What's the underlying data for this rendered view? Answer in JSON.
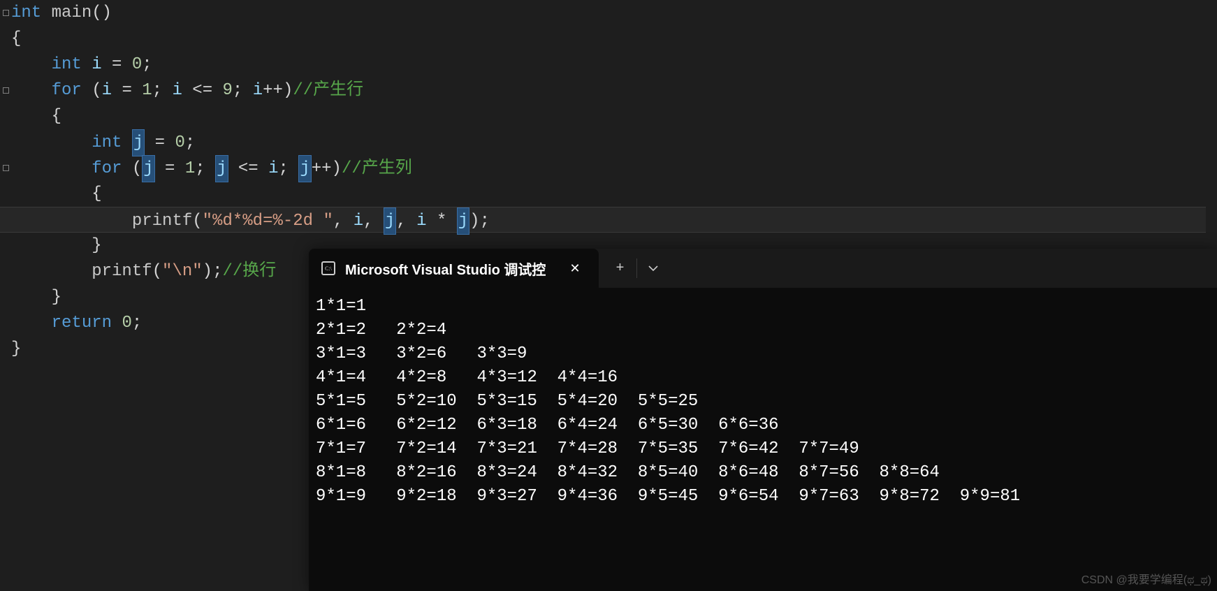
{
  "code": {
    "l1": {
      "int": "int",
      "sp": " ",
      "main": "main",
      "open": "(",
      "close": ")"
    },
    "l2": {
      "brace": "{"
    },
    "l3": {
      "pad": "    ",
      "int": "int",
      "sp": " ",
      "id": "i",
      "eq": " = ",
      "num": "0",
      "semi": ";"
    },
    "l4": {
      "pad": "    ",
      "for": "for",
      "sp": " (",
      "id1": "i",
      "eq1": " = ",
      "n1": "1",
      "semi1": "; ",
      "id2": "i",
      "le": " <= ",
      "n2": "9",
      "semi2": "; ",
      "id3": "i",
      "pp": "++",
      ")": ")",
      "cmm": "//产生行"
    },
    "l5": {
      "pad": "    ",
      "brace": "{"
    },
    "l6": {
      "pad": "        ",
      "int": "int",
      "sp": " ",
      "semi": ";",
      "j": "j",
      "eq": " = ",
      "num": "0"
    },
    "l7": {
      "pad": "        ",
      "for": "for",
      "sp": " (",
      "eq1": " = ",
      "n1": "1",
      "semi1": "; ",
      "le": " <= ",
      "idi": "i",
      "semi2": "; ",
      "pp": "++",
      ")": ")",
      "cmm": "//产生列",
      "j": "j"
    },
    "l8": {
      "pad": "        ",
      "brace": "{"
    },
    "l9": {
      "pad": "            ",
      "printf": "printf",
      "open": "(",
      "str": "\"%d*%d=%-2d \"",
      "c1": ", ",
      "i": "i",
      "c2": ", ",
      "j": "j",
      "c3": ", ",
      "ii": "i",
      "mul": " * ",
      "jj": "j",
      "close": ")",
      "semi": ";"
    },
    "l10": {
      "pad": "        ",
      "brace": "}"
    },
    "l11": {
      "pad": "        ",
      "printf": "printf",
      "open": "(",
      "str": "\"\\n\"",
      "close": ")",
      "semi": ";",
      "cmm": "//换行"
    },
    "l12": {
      "pad": "    ",
      "brace": "}"
    },
    "l13": {
      "pad": "    ",
      "return": "return",
      "sp": " ",
      "num": "0",
      "semi": ";"
    },
    "l14": {
      "brace": "}"
    }
  },
  "terminal": {
    "tab_title": "Microsoft Visual Studio 调试控",
    "icon_text": "C:\\",
    "plus": "+",
    "chevron": "⌄",
    "close": "✕",
    "lines": [
      "1*1=1  ",
      "2*1=2   2*2=4  ",
      "3*1=3   3*2=6   3*3=9  ",
      "4*1=4   4*2=8   4*3=12  4*4=16 ",
      "5*1=5   5*2=10  5*3=15  5*4=20  5*5=25 ",
      "6*1=6   6*2=12  6*3=18  6*4=24  6*5=30  6*6=36 ",
      "7*1=7   7*2=14  7*3=21  7*4=28  7*5=35  7*6=42  7*7=49 ",
      "8*1=8   8*2=16  8*3=24  8*4=32  8*5=40  8*6=48  8*7=56  8*8=64 ",
      "9*1=9   9*2=18  9*3=27  9*4=36  9*5=45  9*6=54  9*7=63  9*8=72  9*9=81"
    ]
  },
  "watermark": "CSDN @我要学编程(ಥ_ಥ)"
}
